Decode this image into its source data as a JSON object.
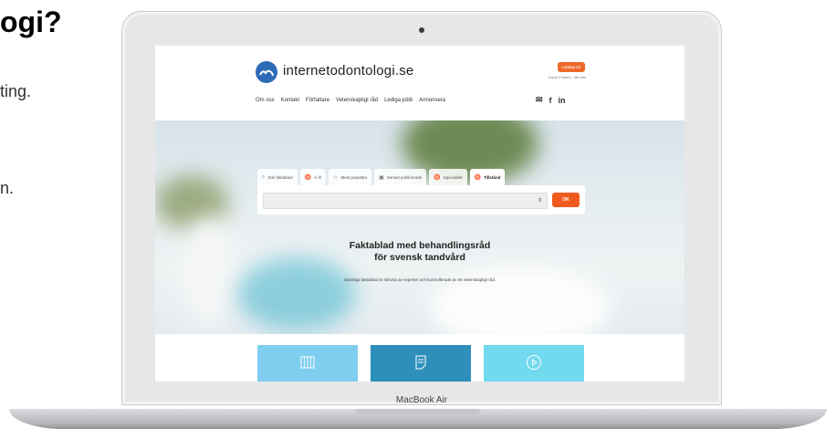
{
  "page": {
    "title_partial": "ogi?",
    "text_partial_1": "ting.",
    "text_partial_2": "n."
  },
  "laptop": {
    "brand": "MacBook Air"
  },
  "site": {
    "logo_text": "internetodontologi.se",
    "logout_label": "LOGGA UT",
    "user_link": "Sophie Ericsson · Min sida",
    "nav": [
      "Om oss",
      "Kontakt",
      "Författare",
      "Vetenskapligt råd",
      "Lediga jobb",
      "Annonsera"
    ],
    "social": [
      "✉",
      "f",
      "in"
    ]
  },
  "search": {
    "tabs": [
      {
        "icon": "search-icon",
        "label": "Sök faktablad"
      },
      {
        "icon": "tooth-icon",
        "label": "A-Ö"
      },
      {
        "icon": "star-icon",
        "label": "Mest populära"
      },
      {
        "icon": "calendar-icon",
        "label": "Senast publicerade"
      },
      {
        "icon": "tooth-icon",
        "label": "Specialitet"
      },
      {
        "icon": "tooth-icon",
        "label": "Tillstånd"
      }
    ],
    "active_tab": "Tillstånd",
    "select_value": "",
    "ok_label": "OK"
  },
  "hero": {
    "title_line1": "Faktablad med behandlingsråd",
    "title_line2": "för svensk tandvård",
    "subtitle": "Samtliga faktablad är skrivna av experter och kontrollerade av ett vetenskapligt råd."
  },
  "cards": [
    {
      "icon": "book-icon",
      "color": "#7fcdef"
    },
    {
      "icon": "document-icon",
      "color": "#2f8fbb"
    },
    {
      "icon": "play-icon",
      "color": "#72daef"
    }
  ],
  "colors": {
    "accent": "#ee5b1d",
    "brand_blue": "#2e6bb6"
  }
}
